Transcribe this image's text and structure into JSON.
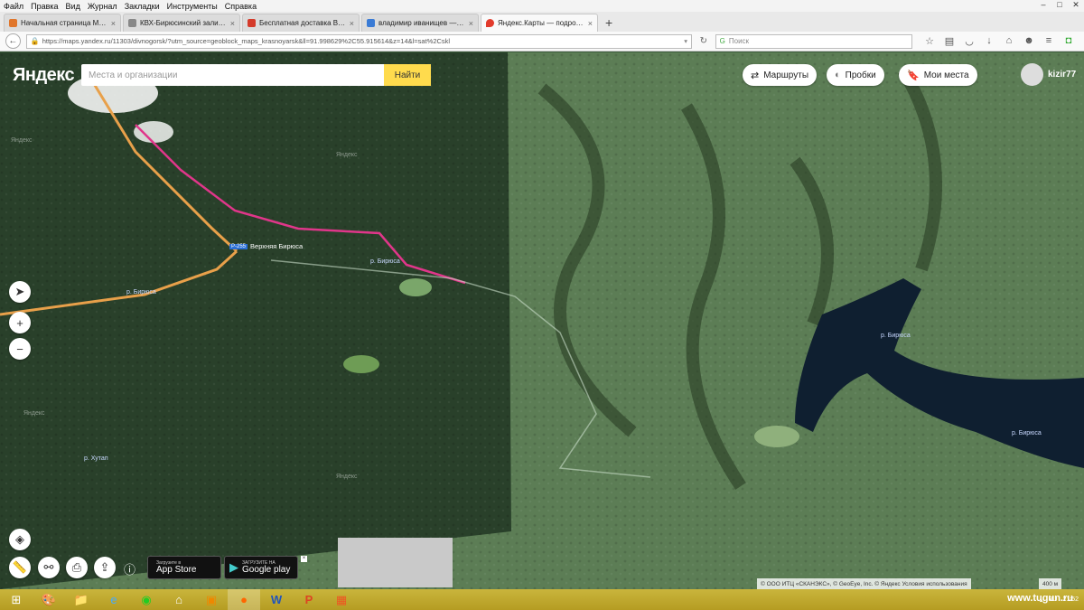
{
  "menu": [
    "Файл",
    "Правка",
    "Вид",
    "Журнал",
    "Закладки",
    "Инструменты",
    "Справка"
  ],
  "window_controls": [
    "–",
    "□",
    "✕"
  ],
  "tabs": [
    {
      "label": "Начальная страница Мо...",
      "color": "#e0762b",
      "active": false
    },
    {
      "label": "КВХ-Бирюсинский залив...",
      "color": "#888888",
      "active": false
    },
    {
      "label": "Бесплатная доставка Выс...",
      "color": "#d43a2a",
      "active": false
    },
    {
      "label": "владимир иванищев — В...",
      "color": "#3a7bd5",
      "active": false
    },
    {
      "label": "Яндекс.Карты — подроб...",
      "color": "#e23b2c",
      "active": true
    }
  ],
  "new_tab": "+",
  "address": {
    "url": "https://maps.yandex.ru/11303/divnogorsk/?utm_source=geoblock_maps_krasnoyarsk&ll=91.998629%2C55.915614&z=14&l=sat%2Cskl"
  },
  "browser_search": {
    "placeholder": "Поиск"
  },
  "map": {
    "logo": "Яндекс",
    "search_placeholder": "Места и организации",
    "find_label": "Найти",
    "routes_label": "Маршруты",
    "traffic_label": "Пробки",
    "my_places_label": "Мои места",
    "username": "kizir77",
    "village": "Верхняя Бирюса",
    "road_badge": "Р-255",
    "labels": [
      {
        "text": "р. Бирюса",
        "cls": "l1"
      },
      {
        "text": "р. Бирюса",
        "cls": "l2"
      },
      {
        "text": "р. Бирюса",
        "cls": "l3"
      },
      {
        "text": "р. Хутап",
        "cls": "l4"
      },
      {
        "text": "р. Бирюса",
        "cls": "l5"
      }
    ],
    "watermarks": [
      "Яндекс",
      "Яндекс",
      "Яндекс",
      "Яндекс"
    ],
    "app_store": {
      "top": "Загрузите в",
      "main": "App Store"
    },
    "google_play": {
      "top": "ЗАГРУЗИТЕ НА",
      "main": "Google play"
    },
    "copyright": "© ООО ИТЦ «СКАНЭКС», © GeoEye, Inc. © Яндекс Условия использования",
    "scale": "400 м"
  },
  "taskbar": {
    "brand": "www.tugun.ru",
    "time": "21:52",
    "lang": "RU"
  }
}
